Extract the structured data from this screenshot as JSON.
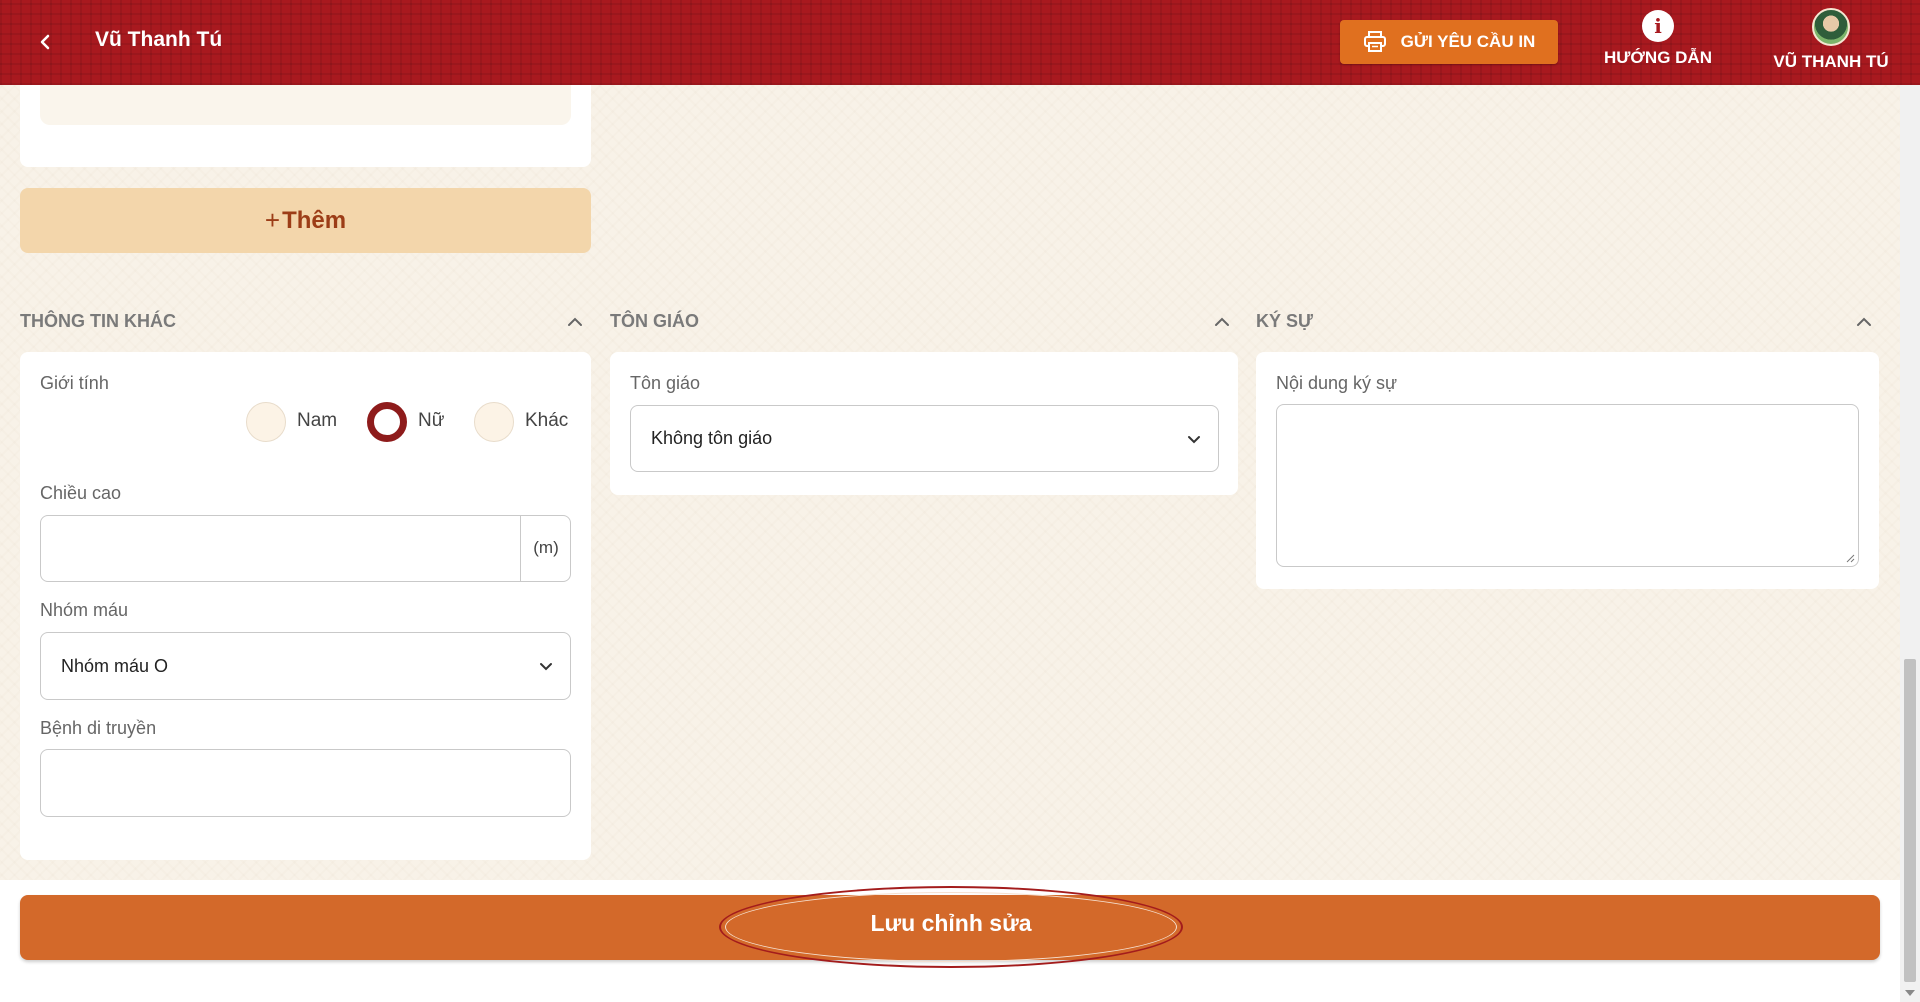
{
  "header": {
    "title": "Vũ Thanh Tú",
    "print_label": "GỬI YÊU CẦU IN",
    "help_label": "HƯỚNG DẪN",
    "user_label": "VŨ THANH TÚ",
    "back_icon": "chevron-left-icon",
    "print_icon": "printer-icon",
    "help_icon": "info-icon"
  },
  "add_button": {
    "plus": "+",
    "label": "Thêm"
  },
  "sections": {
    "other_info": {
      "title": "THÔNG TIN KHÁC",
      "gender_label": "Giới tính",
      "gender_options": [
        "Nam",
        "Nữ",
        "Khác"
      ],
      "gender_selected": "Nữ",
      "height_label": "Chiều cao",
      "height_value": "",
      "height_unit": "(m)",
      "blood_label": "Nhóm máu",
      "blood_value": "Nhóm máu O",
      "disease_label": "Bệnh di truyền",
      "disease_value": ""
    },
    "religion": {
      "title": "TÔN GIÁO",
      "field_label": "Tôn giáo",
      "value": "Không tôn giáo"
    },
    "memoir": {
      "title": "KÝ SỰ",
      "field_label": "Nội dung ký sự",
      "value": ""
    }
  },
  "footer": {
    "save_label": "Lưu chỉnh sửa"
  },
  "colors": {
    "header_red": "#a8191f",
    "accent_orange": "#d3692a",
    "add_button_bg": "#f3d6ab",
    "radio_checked": "#8e1b1b"
  }
}
